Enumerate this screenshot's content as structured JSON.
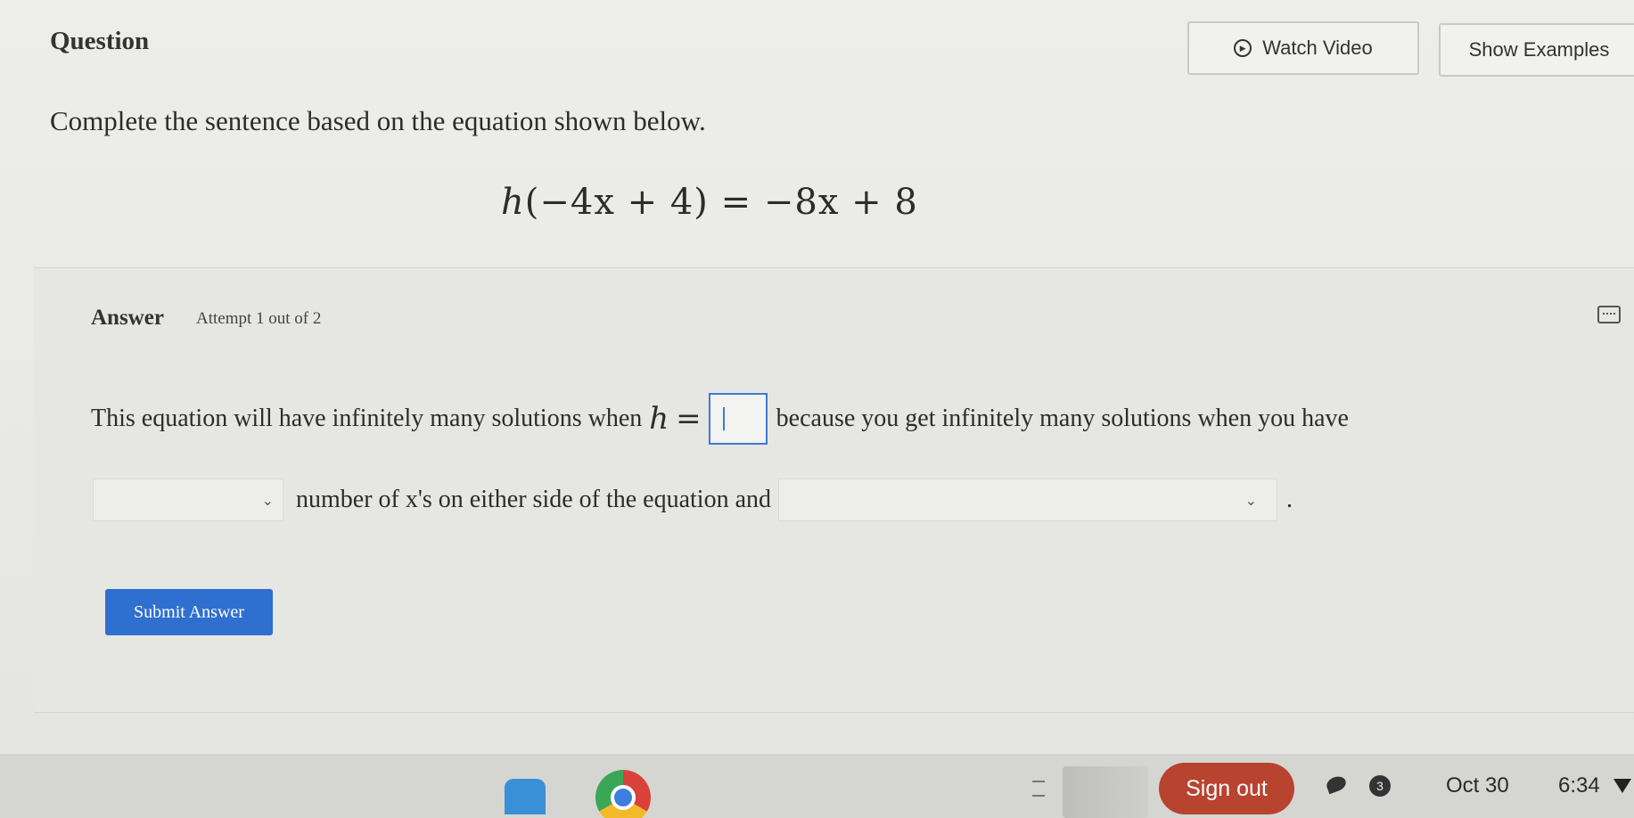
{
  "header": {
    "title": "Question",
    "watch_video_label": "Watch Video",
    "show_examples_label": "Show Examples"
  },
  "question": {
    "instruction": "Complete the sentence based on the equation shown below.",
    "equation": {
      "lhs_var": "h",
      "lhs_rest": "(−4x + 4)",
      "equals": "=",
      "rhs": "−8x + 8"
    }
  },
  "answer": {
    "label": "Answer",
    "attempt": "Attempt 1 out of 2",
    "sentence_part1": "This equation will have infinitely many solutions when",
    "math_var": "h",
    "math_eq": "=",
    "answer_value": "",
    "sentence_part2": "because you get infinitely many solutions when you have",
    "dropdown1_value": "",
    "sentence_part3": "number of x's on either side of the equation and",
    "dropdown2_value": "",
    "period": ".",
    "submit_label": "Submit Answer"
  },
  "taskbar": {
    "sign_out_label": "Sign out",
    "notification_count": "3",
    "date": "Oct 30",
    "time": "6:34"
  },
  "icons": {
    "watch_video": "play-icon",
    "answer_panel": "keyboard-icon",
    "dropdown": "chevron-down-icon",
    "taskbar": [
      "video-call-icon",
      "chrome-icon",
      "mic-icon",
      "wifi-icon"
    ]
  },
  "colors": {
    "accent": "#2f6fd0",
    "input_border": "#3b7bd4",
    "sign_out": "#b8432f"
  }
}
